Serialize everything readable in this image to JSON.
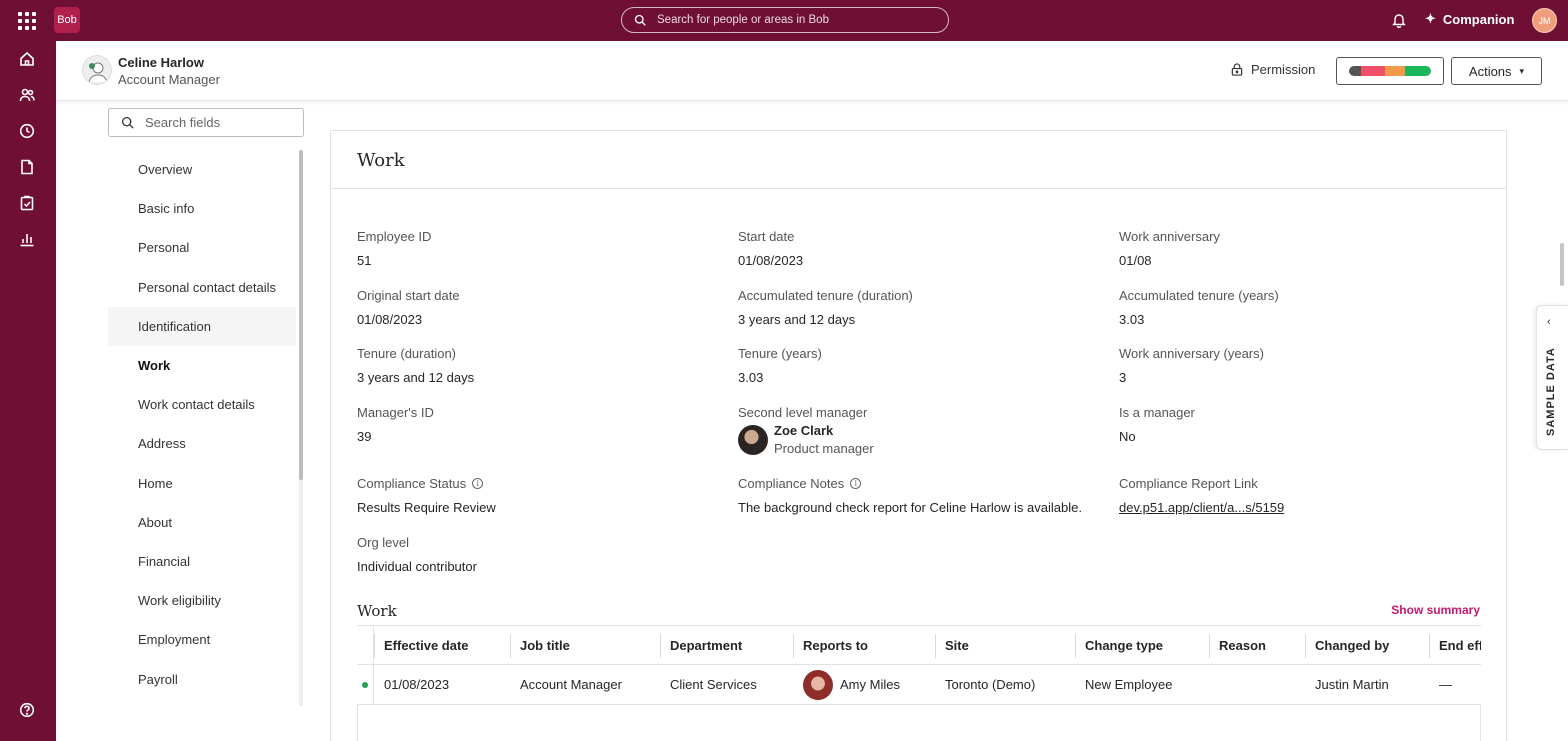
{
  "topbar": {
    "logo": "Bob",
    "search_placeholder": "Search for people or areas in Bob",
    "companion_label": "Companion",
    "user_initials": "JM"
  },
  "profile": {
    "name": "Celine Harlow",
    "title": "Account Manager",
    "permission_label": "Permission",
    "actions_label": "Actions",
    "status_colors": [
      "#555555",
      "#f04f6a",
      "#f2994a",
      "#1bb55c"
    ]
  },
  "nav": {
    "search_placeholder": "Search fields",
    "items": [
      "Overview",
      "Basic info",
      "Personal",
      "Personal contact details",
      "Identification",
      "Work",
      "Work contact details",
      "Address",
      "Home",
      "About",
      "Financial",
      "Work eligibility",
      "Employment",
      "Payroll"
    ],
    "active": "Work",
    "hovered": "Identification"
  },
  "section": {
    "title": "Work",
    "fields": {
      "employee_id": {
        "label": "Employee ID",
        "value": "51"
      },
      "start_date": {
        "label": "Start date",
        "value": "01/08/2023"
      },
      "work_anniversary": {
        "label": "Work anniversary",
        "value": "01/08"
      },
      "original_start_date": {
        "label": "Original start date",
        "value": "01/08/2023"
      },
      "acc_tenure_duration": {
        "label": "Accumulated tenure (duration)",
        "value": "3 years and 12 days"
      },
      "acc_tenure_years": {
        "label": "Accumulated tenure (years)",
        "value": "3.03"
      },
      "tenure_duration": {
        "label": "Tenure (duration)",
        "value": "3 years and 12 days"
      },
      "tenure_years": {
        "label": "Tenure (years)",
        "value": "3.03"
      },
      "work_anniversary_years": {
        "label": "Work anniversary (years)",
        "value": "3"
      },
      "managers_id": {
        "label": "Manager's ID",
        "value": "39"
      },
      "second_level_manager": {
        "label": "Second level manager",
        "name": "Zoe Clark",
        "title": "Product manager"
      },
      "is_manager": {
        "label": "Is a manager",
        "value": "No"
      },
      "compliance_status": {
        "label": "Compliance Status",
        "value": "Results Require Review"
      },
      "compliance_notes": {
        "label": "Compliance Notes",
        "value": "The background check report for Celine Harlow is available."
      },
      "compliance_report_link": {
        "label": "Compliance Report Link",
        "value": "dev.p51.app/client/a...s/5159"
      },
      "org_level": {
        "label": "Org level",
        "value": "Individual contributor"
      }
    }
  },
  "history": {
    "title": "Work",
    "show_summary": "Show summary",
    "columns": [
      "Effective date",
      "Job title",
      "Department",
      "Reports to",
      "Site",
      "Change type",
      "Reason",
      "Changed by",
      "End eff"
    ],
    "rows": [
      {
        "effective_date": "01/08/2023",
        "job_title": "Account Manager",
        "department": "Client Services",
        "reports_to": "Amy Miles",
        "site": "Toronto (Demo)",
        "change_type": "New Employee",
        "reason": "",
        "changed_by": "Justin Martin",
        "end_effective": "—"
      }
    ]
  },
  "sample_tab": {
    "label": "SAMPLE DATA"
  }
}
